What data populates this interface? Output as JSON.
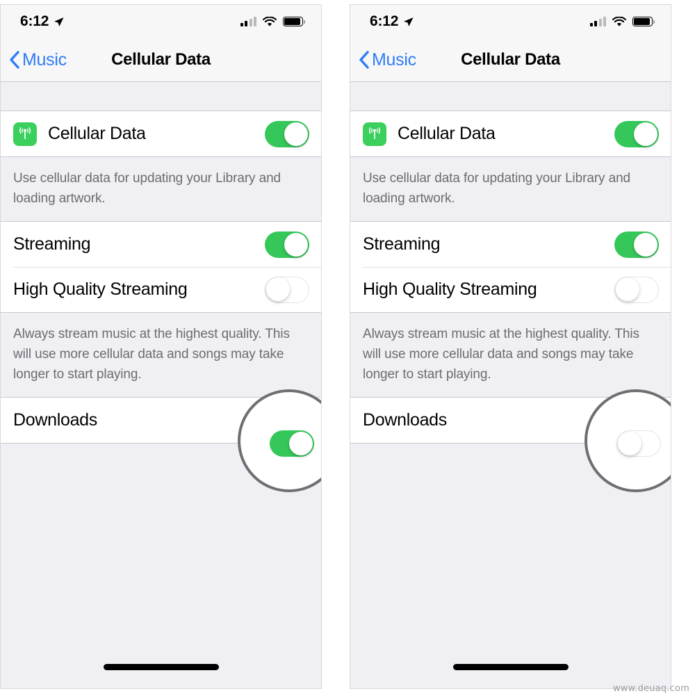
{
  "statusbar": {
    "time": "6:12",
    "location_icon": "location-arrow-icon",
    "signal_icon": "cellular-signal-icon",
    "wifi_icon": "wifi-icon",
    "battery_icon": "battery-full-icon",
    "signal_bars_filled": 2,
    "signal_bars_total": 4
  },
  "navbar": {
    "back_label": "Music",
    "back_icon": "chevron-left-icon",
    "title": "Cellular Data"
  },
  "rows": {
    "cellular_data": {
      "label": "Cellular Data",
      "icon": "cellular-data-icon"
    },
    "streaming": {
      "label": "Streaming"
    },
    "high_quality": {
      "label": "High Quality Streaming"
    },
    "downloads": {
      "label": "Downloads"
    }
  },
  "notes": {
    "cellular": "Use cellular data for updating your Library and loading artwork.",
    "quality": "Always stream music at the highest quality. This will use more cellular data and songs may take longer to start playing."
  },
  "panels": [
    {
      "id": "left",
      "toggles": {
        "cellular_data": "on",
        "streaming": "on",
        "high_quality": "off",
        "downloads": "on"
      },
      "highlight_target": "downloads-toggle"
    },
    {
      "id": "right",
      "toggles": {
        "cellular_data": "on",
        "streaming": "on",
        "high_quality": "off",
        "downloads": "off"
      },
      "highlight_target": "downloads-toggle"
    }
  ],
  "colors": {
    "toggle_on": "#35c759",
    "accent_blue": "#2f7cf6",
    "icon_green": "#3bcf5d",
    "group_bg": "#efeff4",
    "highlight_ring": "#6e6e73"
  },
  "watermark": "www.deuaq.com"
}
